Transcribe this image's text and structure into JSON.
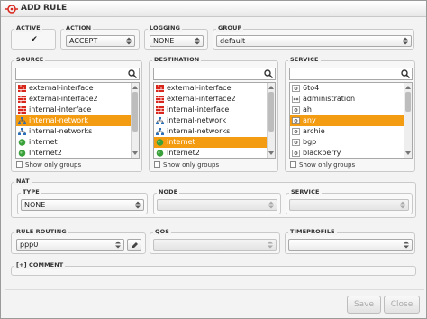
{
  "dialog": {
    "title": "ADD RULE"
  },
  "active": {
    "legend": "ACTIVE",
    "checked_mark": "✔"
  },
  "action": {
    "legend": "ACTION",
    "value": "ACCEPT"
  },
  "logging": {
    "legend": "LOGGING",
    "value": "NONE"
  },
  "group": {
    "legend": "GROUP",
    "value": "default"
  },
  "source": {
    "legend": "SOURCE",
    "search_value": "",
    "show_only_groups": "Show only groups",
    "items": [
      {
        "label": "external-interface",
        "icon": "firewall-icon",
        "selected": false
      },
      {
        "label": "external-interface2",
        "icon": "firewall-icon",
        "selected": false
      },
      {
        "label": "internal-interface",
        "icon": "firewall-icon",
        "selected": false
      },
      {
        "label": "internal-network",
        "icon": "network-icon",
        "selected": true
      },
      {
        "label": "internal-networks",
        "icon": "network-icon",
        "selected": false
      },
      {
        "label": "internet",
        "icon": "globe-icon",
        "selected": false
      },
      {
        "label": "Internet2",
        "icon": "globe-icon",
        "selected": false
      }
    ]
  },
  "destination": {
    "legend": "DESTINATION",
    "search_value": "",
    "show_only_groups": "Show only groups",
    "items": [
      {
        "label": "external-interface",
        "icon": "firewall-icon",
        "selected": false
      },
      {
        "label": "external-interface2",
        "icon": "firewall-icon",
        "selected": false
      },
      {
        "label": "internal-interface",
        "icon": "firewall-icon",
        "selected": false
      },
      {
        "label": "internal-network",
        "icon": "network-icon",
        "selected": false
      },
      {
        "label": "internal-networks",
        "icon": "network-icon",
        "selected": false
      },
      {
        "label": "internet",
        "icon": "globe-icon",
        "selected": true
      },
      {
        "label": "Internet2",
        "icon": "globe-icon",
        "selected": false
      }
    ]
  },
  "service": {
    "legend": "SERVICE",
    "search_value": "",
    "show_only_groups": "Show only groups",
    "items": [
      {
        "label": "6to4",
        "icon": "service-icon",
        "selected": false
      },
      {
        "label": "administration",
        "icon": "service-group-icon",
        "selected": false
      },
      {
        "label": "ah",
        "icon": "service-icon",
        "selected": false
      },
      {
        "label": "any",
        "icon": "service-icon",
        "selected": true
      },
      {
        "label": "archie",
        "icon": "service-icon",
        "selected": false
      },
      {
        "label": "bgp",
        "icon": "service-icon",
        "selected": false
      },
      {
        "label": "blackberry",
        "icon": "service-icon",
        "selected": false
      }
    ]
  },
  "nat": {
    "legend": "NAT",
    "type": {
      "legend": "TYPE",
      "value": "NONE"
    },
    "node": {
      "legend": "NODE",
      "value": ""
    },
    "service": {
      "legend": "SERVICE",
      "value": ""
    }
  },
  "rule_routing": {
    "legend": "RULE ROUTING",
    "value": "ppp0"
  },
  "qos": {
    "legend": "QOS",
    "value": ""
  },
  "timeprofile": {
    "legend": "TIMEPROFILE",
    "value": ""
  },
  "comment": {
    "legend": "[+] COMMENT"
  },
  "footer": {
    "save_label": "Save",
    "close_label": "Close"
  },
  "colors": {
    "selection": "#f39c12",
    "firewall": "#d9261c",
    "globe": "#3aa13a",
    "network": "#2a6fb7"
  }
}
